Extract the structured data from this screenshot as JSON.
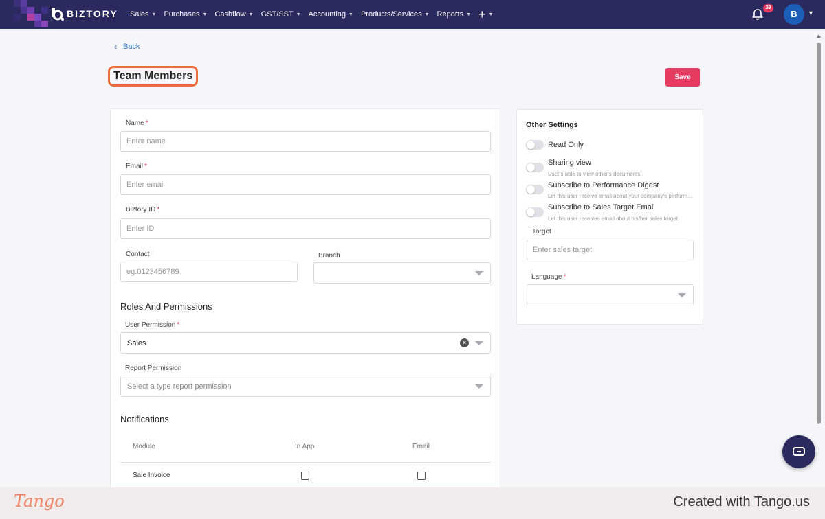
{
  "nav": {
    "brand": "BIZTORY",
    "items": [
      {
        "label": "Sales"
      },
      {
        "label": "Purchases"
      },
      {
        "label": "Cashflow"
      },
      {
        "label": "GST/SST"
      },
      {
        "label": "Accounting"
      },
      {
        "label": "Products/Services"
      },
      {
        "label": "Reports"
      }
    ],
    "plus": "+",
    "notification_count": "29",
    "avatar_initial": "B"
  },
  "header": {
    "back_label": "Back",
    "title": "Team Members",
    "save_label": "Save"
  },
  "form": {
    "name": {
      "label": "Name",
      "placeholder": "Enter name",
      "required": "*"
    },
    "email": {
      "label": "Email",
      "placeholder": "Enter email",
      "required": "*"
    },
    "biztory_id": {
      "label": "Biztory ID",
      "placeholder": "Enter ID",
      "required": "*"
    },
    "contact": {
      "label": "Contact",
      "placeholder": "eg:0123456789"
    },
    "branch": {
      "label": "Branch",
      "value": ""
    },
    "roles_title": "Roles And Permissions",
    "user_permission": {
      "label": "User Permission",
      "required": "*",
      "value": "Sales"
    },
    "report_permission": {
      "label": "Report Permission",
      "placeholder": "Select a type report permission"
    },
    "notifications_title": "Notifications",
    "notif_headers": {
      "module": "Module",
      "in_app": "In App",
      "email": "Email"
    },
    "notif_rows": [
      {
        "module": "Sale Invoice",
        "in_app": false,
        "email": false
      }
    ]
  },
  "other_settings": {
    "title": "Other Settings",
    "options": [
      {
        "label": "Read Only",
        "desc": "",
        "on": false
      },
      {
        "label": "Sharing view",
        "desc": "User's able to view other's documents.",
        "on": false
      },
      {
        "label": "Subscribe to Performance Digest",
        "desc": "Let this user receive email about your company's performance digest",
        "on": false
      },
      {
        "label": "Subscribe to Sales Target Email",
        "desc": "Let this user receives email about his/her sales target",
        "on": false
      }
    ],
    "target": {
      "label": "Target",
      "placeholder": "Enter sales target"
    },
    "language": {
      "label": "Language",
      "required": "*",
      "value": ""
    }
  },
  "footer": {
    "tango_logo": "Tango",
    "created_with": "Created with Tango.us"
  },
  "colors": {
    "nav_bg": "#2a2a5e",
    "accent": "#e63b61",
    "link": "#2a6fb5",
    "highlight": "#ef6c3a"
  }
}
